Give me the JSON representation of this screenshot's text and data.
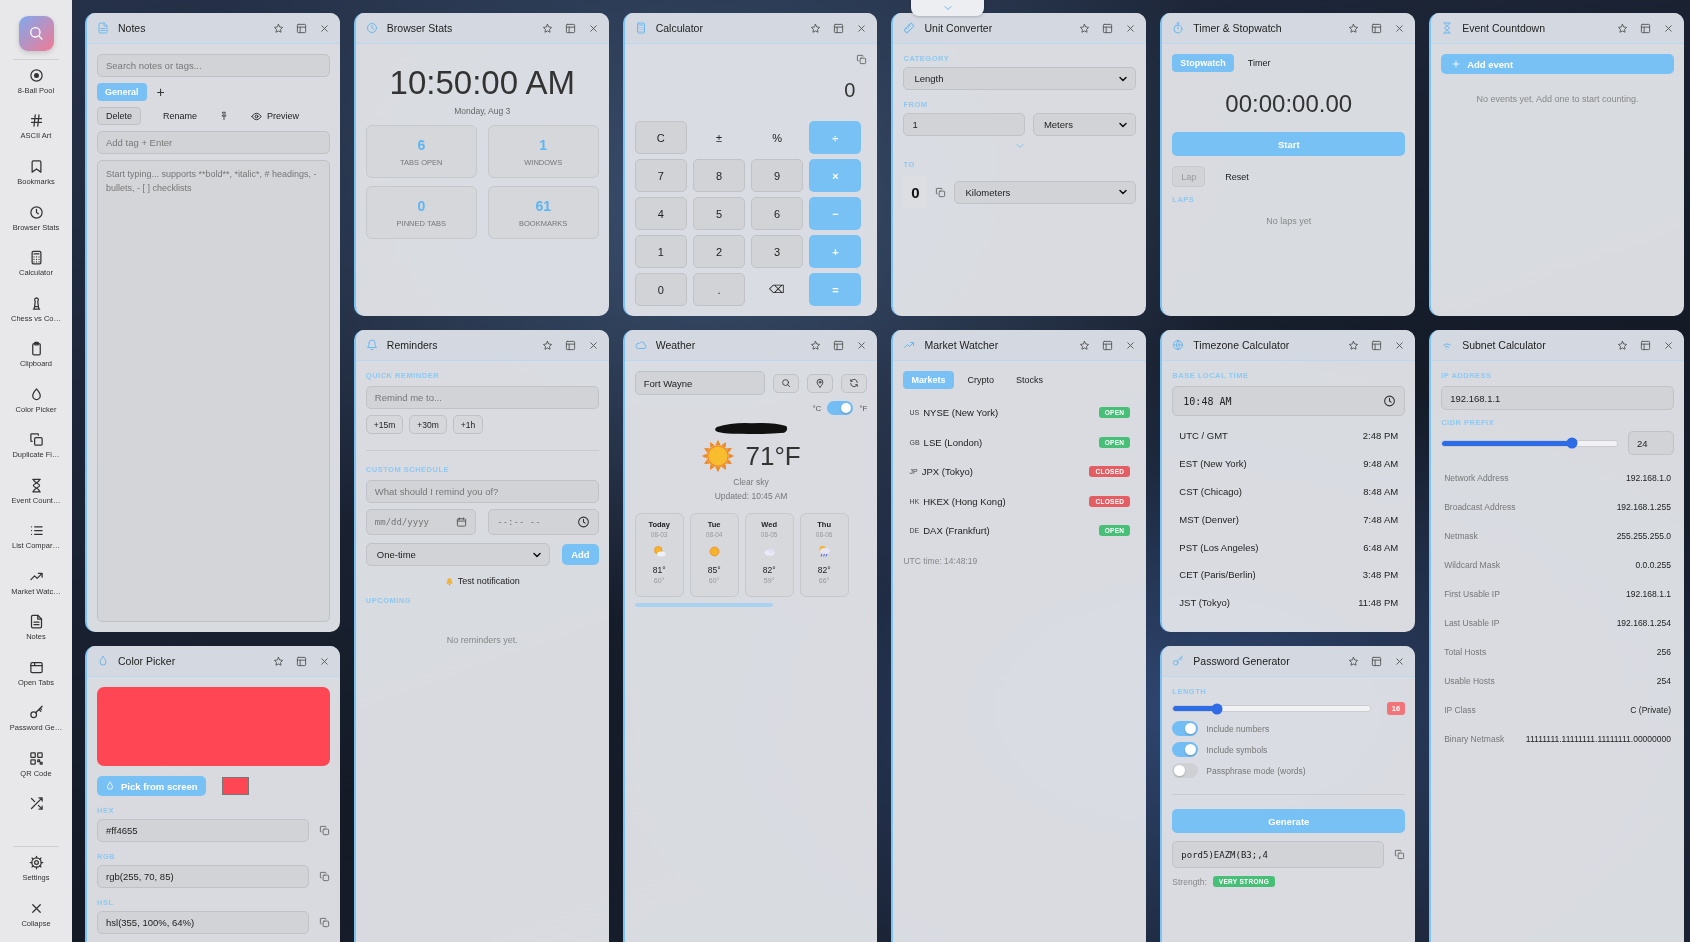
{
  "sidebar": {
    "items": [
      {
        "kind": "app",
        "label": "8-Ball Pool"
      },
      {
        "kind": "app",
        "label": "ASCII Art"
      },
      {
        "kind": "app",
        "label": "Bookmarks"
      },
      {
        "kind": "app",
        "label": "Browser Stats"
      },
      {
        "kind": "app",
        "label": "Calculator"
      },
      {
        "kind": "app",
        "label": "Chess vs Co…"
      },
      {
        "kind": "app",
        "label": "Clipboard"
      },
      {
        "kind": "app",
        "label": "Color Picker"
      },
      {
        "kind": "app",
        "label": "Duplicate Fi…"
      },
      {
        "kind": "app",
        "label": "Event Count…"
      },
      {
        "kind": "app",
        "label": "List Compar…"
      },
      {
        "kind": "app",
        "label": "Market Watc…"
      },
      {
        "kind": "app",
        "label": "Notes"
      },
      {
        "kind": "app",
        "label": "Open Tabs"
      },
      {
        "kind": "app",
        "label": "Password Ge…"
      },
      {
        "kind": "app",
        "label": "QR Code"
      },
      {
        "kind": "icon_only"
      }
    ],
    "footer": [
      {
        "label": "Settings"
      },
      {
        "label": "Collapse"
      }
    ]
  },
  "columns": [
    [
      {
        "kind": "notes",
        "title": "Notes",
        "search_placeholder": "Search notes or tags...",
        "tags": [
          {
            "label": "General",
            "selected": true
          }
        ],
        "add_tag": "+",
        "actions": [
          "Delete",
          "Rename"
        ],
        "preview": "Preview",
        "tag_placeholder": "Add tag + Enter",
        "editor_placeholder": "Start typing... supports **bold**, *italic*, # headings, - bullets, - [ ] checklists"
      },
      {
        "kind": "color_picker",
        "title": "Color Picker",
        "color": "#ff4655",
        "pick_button": "Pick from screen",
        "fields": [
          {
            "label": "HEX",
            "value": "#ff4655"
          },
          {
            "label": "RGB",
            "value": "rgb(255, 70, 85)"
          },
          {
            "label": "HSL",
            "value": "hsl(355, 100%, 64%)"
          }
        ]
      }
    ],
    [
      {
        "kind": "browser_stats",
        "title": "Browser Stats",
        "time": "10:50:00 AM",
        "date": "Monday, Aug 3",
        "stats": [
          {
            "value": "6",
            "label": "TABS OPEN"
          },
          {
            "value": "1",
            "label": "WINDOWS"
          },
          {
            "value": "0",
            "label": "PINNED TABS"
          },
          {
            "value": "61",
            "label": "BOOKMARKS"
          }
        ]
      },
      {
        "kind": "reminders",
        "title": "Reminders",
        "quick_label": "QUICK REMINDER",
        "quick_placeholder": "Remind me to...",
        "presets": [
          "+15m",
          "+30m",
          "+1h"
        ],
        "custom_label": "CUSTOM SCHEDULE",
        "custom_placeholder": "What should I remind you of?",
        "date_placeholder": "mm/dd/yyyy",
        "time_placeholder": "--:-- --",
        "repeat": "One-time",
        "add": "Add",
        "test": "Test notification",
        "upcoming_label": "UPCOMING",
        "empty": "No reminders yet."
      }
    ],
    [
      {
        "kind": "calculator",
        "title": "Calculator",
        "display": "0",
        "keys": [
          {
            "label": "C",
            "kind": "func"
          },
          {
            "label": "±",
            "kind": "plain"
          },
          {
            "label": "%",
            "kind": "plain"
          },
          {
            "label": "÷",
            "kind": "op"
          },
          {
            "label": "7",
            "kind": "num"
          },
          {
            "label": "8",
            "kind": "num"
          },
          {
            "label": "9",
            "kind": "num"
          },
          {
            "label": "×",
            "kind": "op"
          },
          {
            "label": "4",
            "kind": "num"
          },
          {
            "label": "5",
            "kind": "num"
          },
          {
            "label": "6",
            "kind": "num"
          },
          {
            "label": "−",
            "kind": "op"
          },
          {
            "label": "1",
            "kind": "num"
          },
          {
            "label": "2",
            "kind": "num"
          },
          {
            "label": "3",
            "kind": "num"
          },
          {
            "label": "+",
            "kind": "op"
          },
          {
            "label": "0",
            "kind": "num"
          },
          {
            "label": ".",
            "kind": "num"
          },
          {
            "label": "⌫",
            "kind": "plain"
          },
          {
            "label": "=",
            "kind": "op"
          }
        ]
      },
      {
        "kind": "weather",
        "title": "Weather",
        "city": "Fort Wayne",
        "celsius": "°C",
        "fahrenheit": "°F",
        "fahrenheit_on": true,
        "temperature": "71°F",
        "condition": "Clear sky",
        "updated": "Updated: 10:45 AM",
        "forecast": [
          {
            "day": "Today",
            "date": "08-03",
            "high": "81°",
            "low": "60°"
          },
          {
            "day": "Tue",
            "date": "08-04",
            "high": "85°",
            "low": "60°"
          },
          {
            "day": "Wed",
            "date": "08-05",
            "high": "82°",
            "low": "59°"
          },
          {
            "day": "Thu",
            "date": "08-06",
            "high": "82°",
            "low": "66°"
          }
        ]
      }
    ],
    [
      {
        "kind": "unit_converter",
        "title": "Unit Converter",
        "category_label": "CATEGORY",
        "category": "Length",
        "from_label": "FROM",
        "from_value": "1",
        "from_unit": "Meters",
        "to_label": "TO",
        "result": "0",
        "to_unit": "Kilometers"
      },
      {
        "kind": "market_watcher",
        "title": "Market Watcher",
        "tabs": [
          {
            "label": "Markets",
            "selected": true
          },
          {
            "label": "Crypto",
            "selected": false
          },
          {
            "label": "Stocks",
            "selected": false
          }
        ],
        "markets": [
          {
            "code": "US",
            "name": "NYSE (New York)",
            "status": "OPEN",
            "open": true
          },
          {
            "code": "GB",
            "name": "LSE (London)",
            "status": "OPEN",
            "open": true
          },
          {
            "code": "JP",
            "name": "JPX (Tokyo)",
            "status": "CLOSED",
            "open": false
          },
          {
            "code": "HK",
            "name": "HKEX (Hong Kong)",
            "status": "CLOSED",
            "open": false
          },
          {
            "code": "DE",
            "name": "DAX (Frankfurt)",
            "status": "OPEN",
            "open": true
          }
        ],
        "utc": "UTC time: 14:48:19"
      }
    ],
    [
      {
        "kind": "timer",
        "title": "Timer & Stopwatch",
        "tabs": [
          {
            "label": "Stopwatch",
            "selected": true
          },
          {
            "label": "Timer",
            "selected": false
          }
        ],
        "display": "00:00:00.00",
        "start": "Start",
        "lap": {
          "label": "Lap",
          "disabled": true
        },
        "reset": {
          "label": "Reset",
          "disabled": false
        },
        "laps_label": "LAPS",
        "empty": "No laps yet"
      },
      {
        "kind": "timezone",
        "title": "Timezone Calculator",
        "base_label": "BASE LOCAL TIME",
        "base_time": "10:48 AM",
        "zones": [
          {
            "name": "UTC / GMT",
            "time": "2:48 PM"
          },
          {
            "name": "EST (New York)",
            "time": "9:48 AM"
          },
          {
            "name": "CST (Chicago)",
            "time": "8:48 AM"
          },
          {
            "name": "MST (Denver)",
            "time": "7:48 AM"
          },
          {
            "name": "PST (Los Angeles)",
            "time": "6:48 AM"
          },
          {
            "name": "CET (Paris/Berlin)",
            "time": "3:48 PM"
          },
          {
            "name": "JST (Tokyo)",
            "time": "11:48 PM"
          }
        ]
      },
      {
        "kind": "password",
        "title": "Password Generator",
        "length_label": "LENGTH",
        "level": 0.22,
        "length": "16",
        "toggles": [
          {
            "label": "Include numbers",
            "on": true
          },
          {
            "label": "Include symbols",
            "on": true
          },
          {
            "label": "Passphrase mode (words)",
            "on": false
          }
        ],
        "generate": "Generate",
        "password": "pord5)EAZM(B3;,4",
        "strength_label": "Strength:",
        "strength": "VERY STRONG"
      }
    ],
    [
      {
        "kind": "event_countdown",
        "title": "Event Countdown",
        "add": "Add event",
        "empty": "No events yet. Add one to start counting."
      },
      {
        "kind": "subnet",
        "title": "Subnet Calculator",
        "ip_label": "IP ADDRESS",
        "ip": "192.168.1.1",
        "cidr_label": "CIDR PREFIX",
        "level": 0.74,
        "prefix": "24",
        "rows": [
          {
            "label": "Network Address",
            "value": "192.168.1.0"
          },
          {
            "label": "Broadcast Address",
            "value": "192.168.1.255"
          },
          {
            "label": "Netmask",
            "value": "255.255.255.0"
          },
          {
            "label": "Wildcard Mask",
            "value": "0.0.0.255"
          },
          {
            "label": "First Usable IP",
            "value": "192.168.1.1"
          },
          {
            "label": "Last Usable IP",
            "value": "192.168.1.254"
          },
          {
            "label": "Total Hosts",
            "value": "256"
          },
          {
            "label": "Usable Hosts",
            "value": "254"
          },
          {
            "label": "IP Class",
            "value": "C (Private)"
          },
          {
            "label": "Binary Netmask",
            "value": "11111111.11111111.11111111.00000000"
          }
        ]
      }
    ]
  ]
}
